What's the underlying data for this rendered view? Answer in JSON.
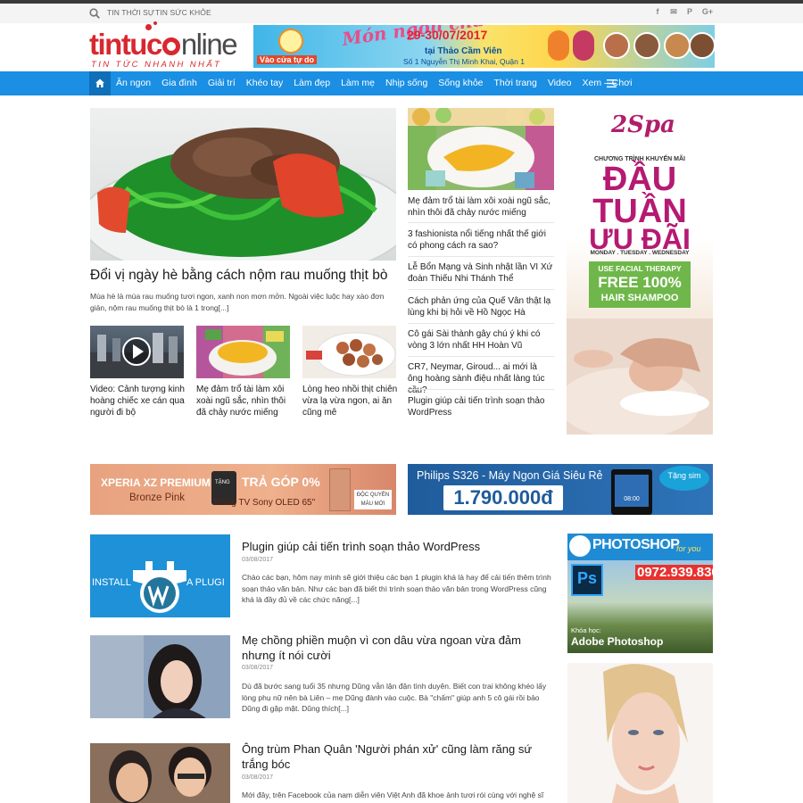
{
  "topbar": {
    "links": [
      "TIN THỜI SỰ",
      "TIN SỨC KHỎE"
    ],
    "social_icons": [
      "facebook-icon",
      "mail-icon",
      "pinterest-icon",
      "google-plus-icon"
    ],
    "social_glyphs": [
      "f",
      "✉",
      "P",
      "G+"
    ]
  },
  "logo": {
    "brand_a": "tintuc",
    "brand_b": "nline",
    "tagline": "TIN TỨC NHANH NHẤT"
  },
  "top_ad": {
    "title": "Món ngon chào hè",
    "date": "29-30/07/2017",
    "place": "tại Thảo Cầm Viên",
    "address": "Số 1 Nguyễn Thị Minh Khai, Quận 1",
    "entry": "Vào cửa tự do"
  },
  "nav": {
    "items": [
      "Ăn ngon",
      "Gia đình",
      "Giải trí",
      "Khéo tay",
      "Làm đẹp",
      "Làm mẹ",
      "Nhịp sống",
      "Sống khỏe",
      "Thời trang",
      "Video",
      "Xem – Chơi"
    ]
  },
  "featured": {
    "title": "Đổi vị ngày hè bằng cách nộm rau muống thịt bò",
    "excerpt": "Mùa hè là mùa rau muống tươi ngon, xanh non mơn mởn. Ngoài việc luộc hay xào đơn giản, nộm rau muống thịt bò là 1 trong[...]"
  },
  "small_cards": [
    {
      "title": "Video: Cảnh tượng kinh hoàng chiếc xe cán qua người đi bộ"
    },
    {
      "title": "Mẹ đảm trổ tài làm xôi xoài ngũ sắc, nhìn thôi đã chảy nước miếng"
    },
    {
      "title": "Lòng heo nhồi thịt chiên vừa lạ vừa ngon, ai ăn cũng mê"
    }
  ],
  "side_list": {
    "top_title": "Mẹ đảm trổ tài làm xôi xoài ngũ sắc, nhìn thôi đã chảy nước miếng",
    "items": [
      "3 fashionista nổi tiếng nhất thế giới có phong cách ra sao?",
      "Lễ Bổn Mạng và Sinh nhật lần VI Xứ đoàn Thiếu Nhi Thánh Thể",
      "Cách phản ứng của Quế Vân thật lạ lùng khi bị hỏi về Hồ Ngọc Hà",
      "Cô gái Sài thành gây chú ý khi có vòng 3 lớn nhất HH Hoàn Vũ",
      "CR7, Neymar, Giroud... ai mới là ông hoàng sành điệu nhất làng túc cầu?",
      "Plugin giúp cải tiến trình soạn thảo WordPress"
    ]
  },
  "spa_ad": {
    "brand": "2Spa",
    "program": "CHƯƠNG TRÌNH KHUYẾN MÃI",
    "headline_1": "ĐẦU",
    "headline_2": "TUẦN",
    "headline_3": "ƯU ĐÃI",
    "days": "MONDAY . TUESDAY . WEDNESDAY",
    "offer_1": "USE FACIAL THERAPY",
    "offer_2": "FREE 100%",
    "offer_3": "HAIR SHAMPOO"
  },
  "banners": {
    "sony": {
      "model": "XPERIA XZ PREMIUM",
      "color": "Bronze Pink",
      "tang": "TẶNG",
      "offer": "TRẢ GÓP 0%",
      "gift": "Trúng TV Sony OLED 65\"",
      "badge": "ĐỘC QUYỀN MÀU MỚI"
    },
    "philips": {
      "model": "Philips S326 - Máy Ngon Giá Siêu Rẻ",
      "price": "1.790.000đ",
      "gift": "Tặng sim",
      "screen_time": "08:00"
    }
  },
  "articles": [
    {
      "title": "Plugin giúp cải tiến trình soạn thảo WordPress",
      "date": "03/08/2017",
      "excerpt": "Chào các bạn, hôm nay mình sẽ giới thiệu các bạn 1 plugin khá là hay để cải tiến thêm trình soạn thảo văn bản. Như các bạn đã biết thì trình soạn thảo văn bản trong WordPress cũng khá là đầy đủ về các chức năng[...]",
      "thumb_text_left": "INSTALL",
      "thumb_text_right": "A PLUGI"
    },
    {
      "title": "Mẹ chồng phiền muộn vì con dâu vừa ngoan vừa đảm nhưng ít nói cười",
      "date": "03/08/2017",
      "excerpt": "Dù đã bước sang tuổi 35 nhưng Dũng vẫn lận đận tình duyên. Biết con trai không khéo lấy lòng phụ nữ nên bà Liên – mẹ Dũng đành vào cuộc. Bà \"chấm\" giúp anh 5 cô gái rồi bảo Dũng đi gặp mặt. Dũng thích[...]"
    },
    {
      "title": "Ông trùm Phan Quân 'Người phán xử' cũng làm răng sứ trắng bóc",
      "date": "03/08/2017",
      "excerpt": "Mới đây, trên Facebook của nam diễn viên Việt Anh đã khoe ảnh tươi rói cùng với nghệ sĩ"
    }
  ],
  "photoshop_ad": {
    "title": "PHOTOSHOP",
    "for_you": "for you",
    "phone": "0972.939.830",
    "course_label": "Khóa học:",
    "course": "Adobe Photoshop",
    "ps": "Ps"
  }
}
